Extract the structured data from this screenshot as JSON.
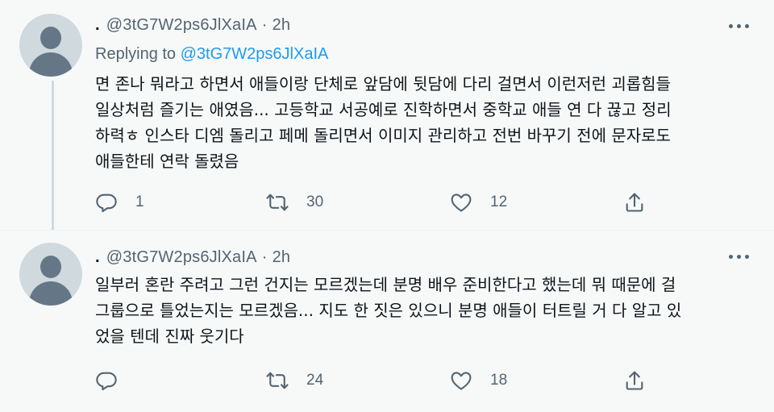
{
  "tweets": [
    {
      "dot": ".",
      "handle": "@3tG7W2ps6JlXaIA",
      "separator": "·",
      "time": "2h",
      "replying_prefix": "Replying to",
      "replying_handle": "@3tG7W2ps6JlXaIA",
      "text": "면 존나 뭐라고 하면서 애들이랑 단체로 앞담에 뒷담에 다리 걸면서 이런저런 괴롭힘들\n일상처럼 즐기는 애였음... 고등학교 서공예로 진학하면서 중학교 애들 연 다 끊고 정리\n하력ㅎ 인스타 디엠 돌리고 페메 돌리면서 이미지 관리하고 전번 바꾸기 전에 문자로도\n애들한테 연락 돌렸음",
      "replies": "1",
      "retweets": "30",
      "likes": "12"
    },
    {
      "dot": ".",
      "handle": "@3tG7W2ps6JlXaIA",
      "separator": "·",
      "time": "2h",
      "text": "일부러 혼란 주려고 그런 건지는 모르겠는데 분명 배우 준비한다고 했는데 뭐 때문에 걸\n그룹으로 틀었는지는 모르겠음... 지도 한 짓은 있으니 분명 애들이 터트릴 거 다 알고 있\n었을 텐데 진짜 웃기다",
      "replies": "",
      "retweets": "24",
      "likes": "18"
    }
  ],
  "icons": {
    "reply": "reply-icon",
    "retweet": "retweet-icon",
    "like": "heart-icon",
    "share": "share-icon",
    "more": "more-icon"
  },
  "colors": {
    "secondary_text": "#536471",
    "link": "#1d9bf0",
    "background": "#f7f9f9"
  }
}
